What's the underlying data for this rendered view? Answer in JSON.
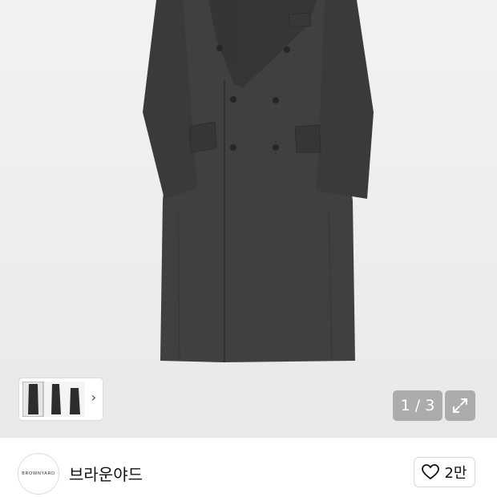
{
  "gallery": {
    "counter": "1 / 3",
    "image": "charcoal-double-breasted-coat",
    "thumbnails": [
      "coat-front",
      "coat-side",
      "coat-back"
    ]
  },
  "icons": {
    "next": "chevron-right-icon",
    "expand": "expand-icon",
    "like": "heart-outline-icon"
  },
  "brand": {
    "logo_text": "BROWNYARD",
    "name": "브라운야드",
    "like_count": "2만"
  },
  "colors": {
    "coat": "#3f3f3f",
    "overlay": "#8a8a8a"
  }
}
